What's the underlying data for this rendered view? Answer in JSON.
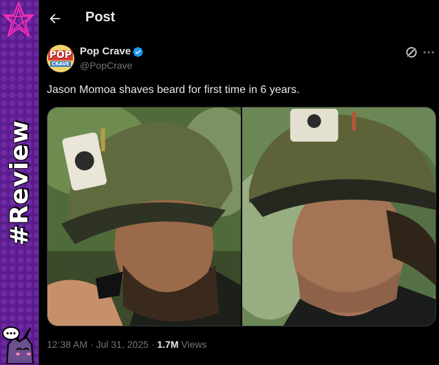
{
  "sidebar": {
    "tag_text": "#Review"
  },
  "header": {
    "title": "Post"
  },
  "post": {
    "author_name": "Pop Crave",
    "author_handle": "@PopCrave",
    "avatar_line1": "POP",
    "avatar_line2": "CRAVE",
    "text": "Jason Momoa shaves beard for first time in 6 years.",
    "time": "12:38 AM",
    "date": "Jul 31, 2025",
    "views_count": "1.7M",
    "views_label": "Views",
    "separator": "·"
  },
  "colors": {
    "background": "#000000",
    "text_primary": "#e7e9ea",
    "text_secondary": "#71767b",
    "verified": "#1d9bf0",
    "sidebar": "#5a1b8c"
  },
  "icons": [
    "back-arrow-icon",
    "verified-badge-icon",
    "grok-icon",
    "more-icon"
  ]
}
